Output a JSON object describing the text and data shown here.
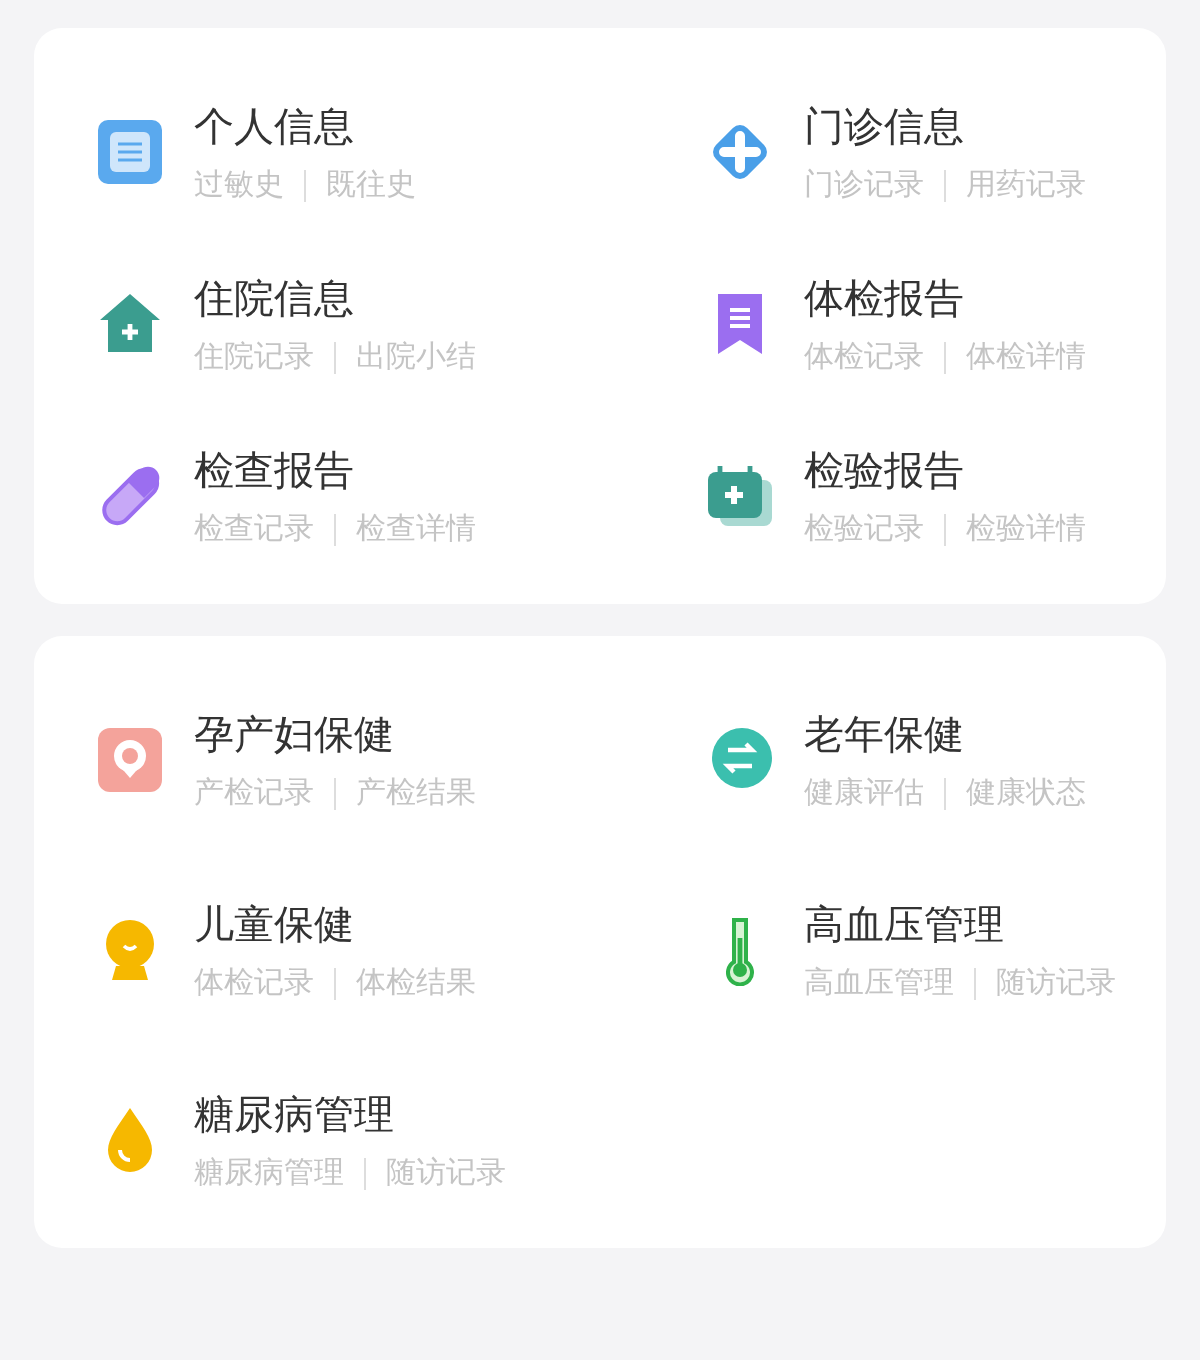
{
  "sections": [
    {
      "items": [
        {
          "title": "个人信息",
          "links": [
            "过敏史",
            "既往史"
          ]
        },
        {
          "title": "门诊信息",
          "links": [
            "门诊记录",
            "用药记录"
          ]
        },
        {
          "title": "住院信息",
          "links": [
            "住院记录",
            "出院小结"
          ]
        },
        {
          "title": "体检报告",
          "links": [
            "体检记录",
            "体检详情"
          ]
        },
        {
          "title": "检查报告",
          "links": [
            "检查记录",
            "检查详情"
          ]
        },
        {
          "title": "检验报告",
          "links": [
            "检验记录",
            "检验详情"
          ]
        }
      ]
    },
    {
      "items": [
        {
          "title": "孕产妇保健",
          "links": [
            "产检记录",
            "产检结果"
          ]
        },
        {
          "title": "老年保健",
          "links": [
            "健康评估",
            "健康状态"
          ]
        },
        {
          "title": "儿童保健",
          "links": [
            "体检记录",
            "体检结果"
          ]
        },
        {
          "title": "高血压管理",
          "links": [
            "高血压管理",
            "随访记录"
          ]
        },
        {
          "title": "糖尿病管理",
          "links": [
            "糖尿病管理",
            "随访记录"
          ]
        }
      ]
    }
  ]
}
